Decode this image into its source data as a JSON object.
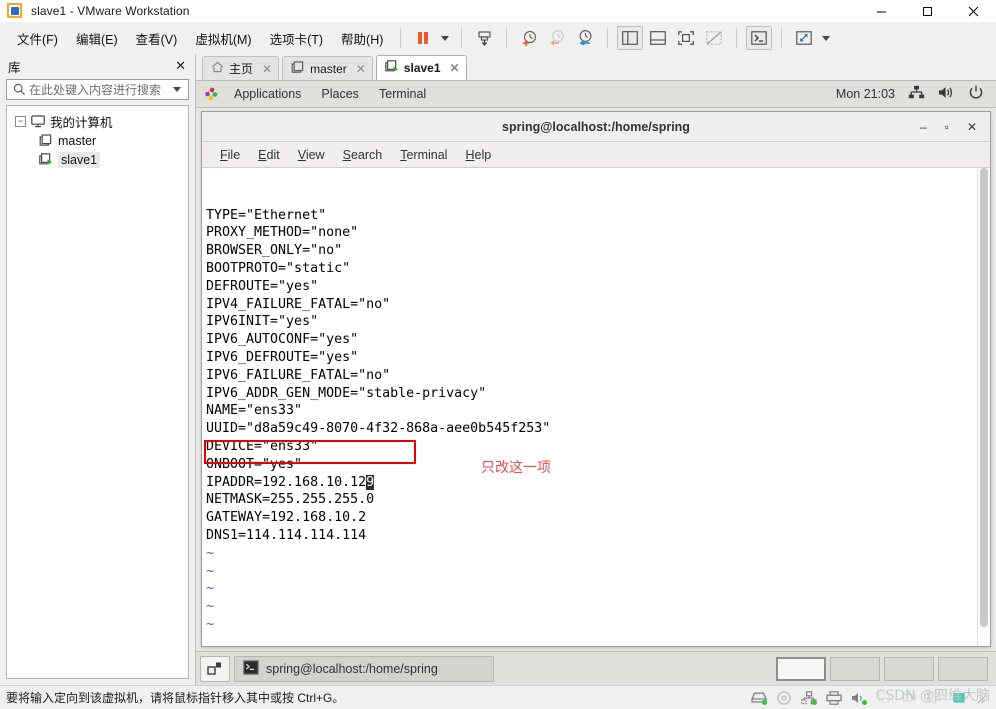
{
  "window": {
    "title": "slave1 - VMware Workstation",
    "controls": {
      "minimize": "—",
      "maximize": "□",
      "close": "✕"
    }
  },
  "menubar": {
    "items": [
      "文件(F)",
      "编辑(E)",
      "查看(V)",
      "虚拟机(M)",
      "选项卡(T)",
      "帮助(H)"
    ],
    "toolbar_icons": [
      "pause-icon",
      "dropdown-caret-icon",
      "snapshot-take-icon",
      "snapshot-manage-icon",
      "snapshot-revert-icon",
      "snapshot-settings-icon",
      "show-library-icon",
      "show-thumbnail-bar-icon",
      "enter-fullscreen-icon",
      "unity-mode-icon",
      "console-view-icon",
      "stretch-guest-icon"
    ]
  },
  "library": {
    "title": "库",
    "close_label": "✕",
    "search_placeholder": "在此处键入内容进行搜索",
    "tree": [
      {
        "label": "我的计算机",
        "level": 0,
        "icon": "monitor-icon",
        "expanded": true,
        "expander": "−"
      },
      {
        "label": "master",
        "level": 1,
        "icon": "vm-stopped-icon",
        "selected": false
      },
      {
        "label": "slave1",
        "level": 1,
        "icon": "vm-running-icon",
        "selected": true
      }
    ]
  },
  "tabs": [
    {
      "label": "主页",
      "icon": "home-icon",
      "active": false,
      "close": "✕"
    },
    {
      "label": "master",
      "icon": "vm-stopped-icon",
      "active": false,
      "close": "✕"
    },
    {
      "label": "slave1",
      "icon": "vm-running-icon",
      "active": true,
      "close": "✕"
    }
  ],
  "guest": {
    "topbar": {
      "applications": "Applications",
      "places": "Places",
      "terminal": "Terminal",
      "clock": "Mon 21:03",
      "icons": [
        "network-icon",
        "volume-icon",
        "power-icon"
      ]
    },
    "terminal_window": {
      "title": "spring@localhost:/home/spring",
      "controls": {
        "minimize": "‒",
        "maximize": "▫",
        "close": "✕"
      },
      "menus": [
        "File",
        "Edit",
        "View",
        "Search",
        "Terminal",
        "Help"
      ],
      "content_lines": [
        "TYPE=\"Ethernet\"",
        "PROXY_METHOD=\"none\"",
        "BROWSER_ONLY=\"no\"",
        "BOOTPROTO=\"static\"",
        "DEFROUTE=\"yes\"",
        "IPV4_FAILURE_FATAL=\"no\"",
        "IPV6INIT=\"yes\"",
        "IPV6_AUTOCONF=\"yes\"",
        "IPV6_DEFROUTE=\"yes\"",
        "IPV6_FAILURE_FATAL=\"no\"",
        "IPV6_ADDR_GEN_MODE=\"stable-privacy\"",
        "NAME=\"ens33\"",
        "UUID=\"d8a59c49-8070-4f32-868a-aee0b545f253\"",
        "DEVICE=\"ens33\"",
        "ONBOOT=\"yes\""
      ],
      "highlighted_line_prefix": "IPADDR=192.168.10.12",
      "highlighted_line_cursor": "9",
      "content_lines_after": [
        "NETMASK=255.255.255.0",
        "GATEWAY=192.168.10.2",
        "DNS1=114.114.114.114"
      ],
      "empty_markers": [
        "~",
        "~",
        "~",
        "~",
        "~"
      ],
      "annotation": "只改这一项",
      "annotation_color": "#ef4b4b",
      "highlight_box_color": "#e60000"
    },
    "taskbar": {
      "show_desktop_icon": "show-desktop-icon",
      "task_label": "spring@localhost:/home/spring",
      "task_icon": "terminal-icon",
      "workspaces": [
        {
          "active": true
        },
        {
          "active": false
        },
        {
          "active": false
        },
        {
          "active": false
        }
      ]
    }
  },
  "statusbar": {
    "message": "要将输入定向到该虚拟机，请将鼠标指针移入其中或按 Ctrl+G。",
    "device_icons": [
      "hard-disk-icon",
      "cd-dvd-icon",
      "network-adapter-icon",
      "printer-icon",
      "sound-card-icon",
      "usb-icon",
      "camera-icon",
      "display-icon",
      "more-devices-icon"
    ]
  },
  "watermark": "CSDN @四维大脑"
}
